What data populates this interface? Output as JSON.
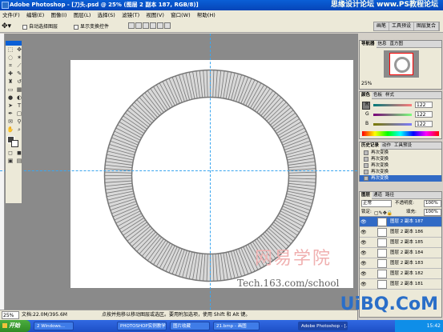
{
  "window": {
    "title": "Adobe Photoshop - [刀头.psd @ 25% (图层 2 副本 187, RGB/8)]"
  },
  "watermark_top": "思缘设计论坛 www.PS教程论坛",
  "menu": [
    "文件(F)",
    "编辑(E)",
    "图像(I)",
    "图层(L)",
    "选择(S)",
    "滤镜(T)",
    "视图(V)",
    "窗口(W)",
    "帮助(H)"
  ],
  "options": {
    "auto_select": "自动选择图层",
    "show_bounds": "显示变换控件"
  },
  "palette_well": [
    "画笔",
    "工具预设",
    "图层复合"
  ],
  "status": {
    "zoom": "25%",
    "doc": "文档:22.0M/395.6M",
    "hint": "点按并拖移以移动图层或选区。要用附加选项，使用 Shift 和 Alt 键。"
  },
  "navigator": {
    "tabs": [
      "导航器",
      "信息",
      "直方图"
    ],
    "zoom": "25%"
  },
  "color": {
    "tabs": [
      "颜色",
      "色板",
      "样式"
    ],
    "rows": [
      {
        "label": "R",
        "value": "122",
        "gradient": "linear-gradient(90deg,#007a7a,#ff7a7a)"
      },
      {
        "label": "G",
        "value": "122",
        "gradient": "linear-gradient(90deg,#7a007a,#7aff7a)"
      },
      {
        "label": "B",
        "value": "122",
        "gradient": "linear-gradient(90deg,#7a7a00,#7a7aff)"
      }
    ]
  },
  "history": {
    "tabs": [
      "历史记录",
      "动作",
      "工具预设"
    ],
    "items": [
      "再次变换",
      "再次变换",
      "再次变换",
      "再次变换",
      "再次变换"
    ]
  },
  "layers": {
    "tabs": [
      "图层",
      "通道",
      "路径"
    ],
    "blend_mode": "正常",
    "opacity_label": "不透明度:",
    "opacity": "100%",
    "lock_label": "锁定:",
    "fill_label": "填充:",
    "fill": "100%",
    "items": [
      "图层 2 副本 187",
      "图层 2 副本 186",
      "图层 2 副本 185",
      "图层 2 副本 184",
      "图层 2 副本 183",
      "图层 2 副本 182",
      "图层 2 副本 181"
    ]
  },
  "watermark": {
    "cn": "网易学院",
    "url": "Tech.163.com/school",
    "corner": "UiBQ.CoM"
  },
  "taskbar": {
    "start": "开始",
    "tasks": [
      "2 Windows...",
      "PHOTOSHOP实例教学",
      "图片收藏",
      "21.bmp - 画图",
      "Adobe Photoshop - [..."
    ],
    "clock": "15:42"
  }
}
